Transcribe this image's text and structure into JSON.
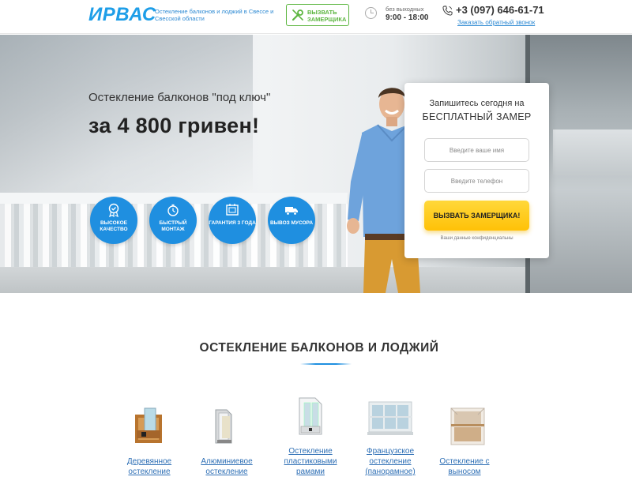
{
  "header": {
    "logo": "ИРВАС",
    "tagline": "Остекление балконов и лоджий в Свессе и Свесской области",
    "call_button": "ВЫЗВАТЬ ЗАМЕРЩИКА",
    "hours_note": "без выходных",
    "hours": "9:00 - 18:00",
    "phone": "+3 (097) 646-61-71",
    "callback_link": "Заказать обратный звонок"
  },
  "hero": {
    "subtitle": "Остекление балконов \"под ключ\"",
    "title": "за 4 800 гривен!",
    "badges": [
      {
        "label": "ВЫСОКОЕ КАЧЕСТВО",
        "icon": "medal-icon"
      },
      {
        "label": "БЫСТРЫЙ МОНТАЖ",
        "icon": "stopwatch-icon"
      },
      {
        "label": "ГАРАНТИЯ 3 ГОДА",
        "icon": "certificate-icon"
      },
      {
        "label": "ВЫВОЗ МУСОРА",
        "icon": "truck-icon"
      }
    ]
  },
  "form": {
    "title_line1": "Запишитесь сегодня на",
    "title_line2": "БЕСПЛАТНЫЙ ЗАМЕР",
    "name_placeholder": "Введите ваше имя",
    "phone_placeholder": "Введите телефон",
    "submit": "ВЫЗВАТЬ ЗАМЕРЩИКА!",
    "privacy": "Ваши данные конфиденциальны"
  },
  "section": {
    "title": "ОСТЕКЛЕНИЕ БАЛКОНОВ И ЛОДЖИЙ",
    "products": [
      {
        "label": "Деревянное остекление"
      },
      {
        "label": "Алюминиевое остекление"
      },
      {
        "label": "Остекление пластиковыми рамами"
      },
      {
        "label": "Французское остекление (панорамное)"
      },
      {
        "label": "Остекление с выносом"
      }
    ]
  },
  "colors": {
    "brand_blue": "#1e9ee8",
    "badge_blue": "#1f8fe0",
    "accent_green": "#5db641",
    "cta_yellow": "#ffc107",
    "link_blue": "#2e6fb5"
  }
}
